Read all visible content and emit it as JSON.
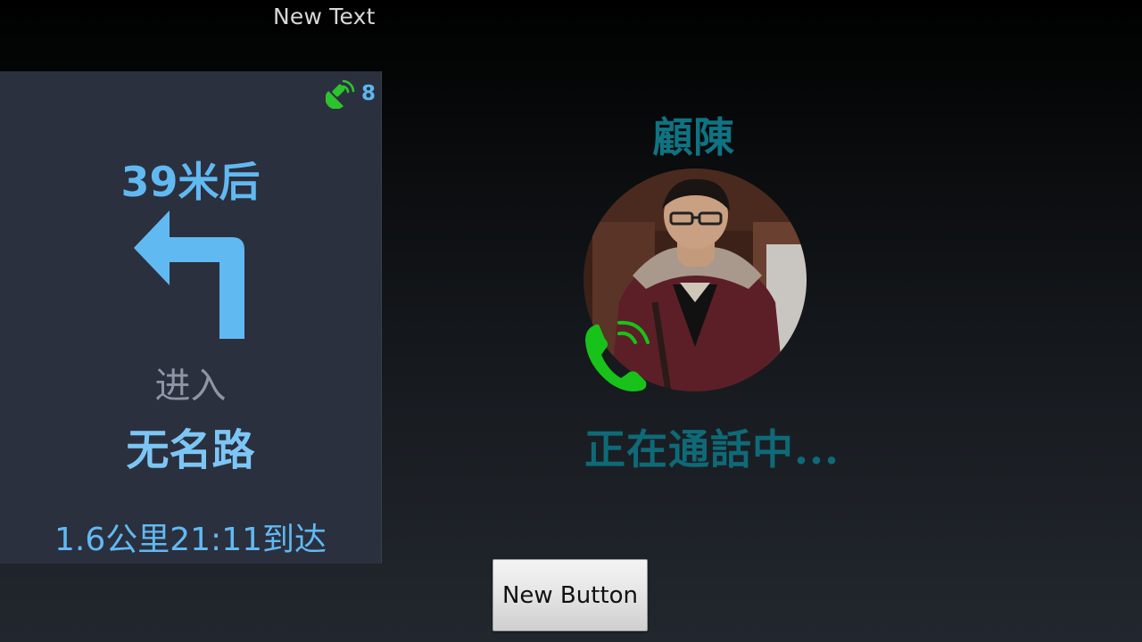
{
  "top_text": "New Text",
  "navigation": {
    "gps_satellite_count": "8",
    "distance_text": "39米后",
    "turn_icon": "turn-left-arrow-icon",
    "enter_label": "进入",
    "road_name": "无名路",
    "eta_text": "1.6公里21:11到达",
    "colors": {
      "panel_bg": "#2b303e",
      "accent_blue": "#61b9f2",
      "gps_green": "#2fc22f"
    }
  },
  "call": {
    "caller_name": "顧陳",
    "status_text": "正在通話中...",
    "phone_icon": "phone-icon",
    "colors": {
      "teal": "#0f7383",
      "phone_green": "#18c21a"
    }
  },
  "button": {
    "label": "New Button"
  }
}
